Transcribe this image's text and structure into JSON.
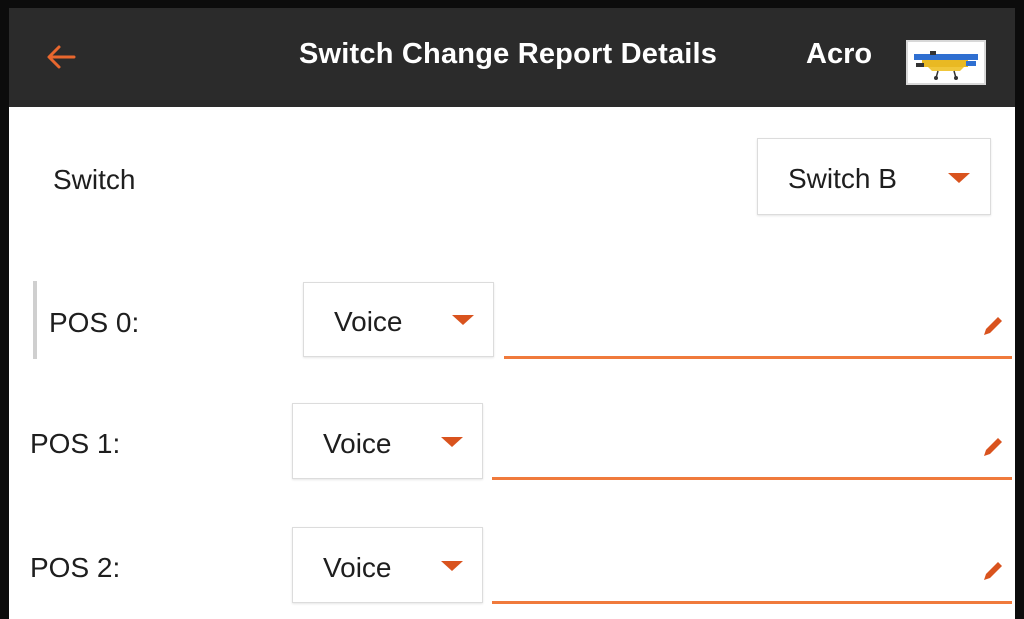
{
  "header": {
    "back_icon": "arrow-left-icon",
    "title": "Switch Change Report Details",
    "model_name": "Acro",
    "model_thumbnail_icon": "airplane-thumbnail-icon"
  },
  "switch_row": {
    "label": "Switch",
    "selected": "Switch B"
  },
  "positions": [
    {
      "label": "POS 0:",
      "mode": "Voice",
      "value": ""
    },
    {
      "label": "POS 1:",
      "mode": "Voice",
      "value": ""
    },
    {
      "label": "POS 2:",
      "mode": "Voice",
      "value": ""
    }
  ],
  "colors": {
    "accent": "#d9531e",
    "underline": "#f07a3c",
    "header_bg": "#2b2b2b"
  }
}
